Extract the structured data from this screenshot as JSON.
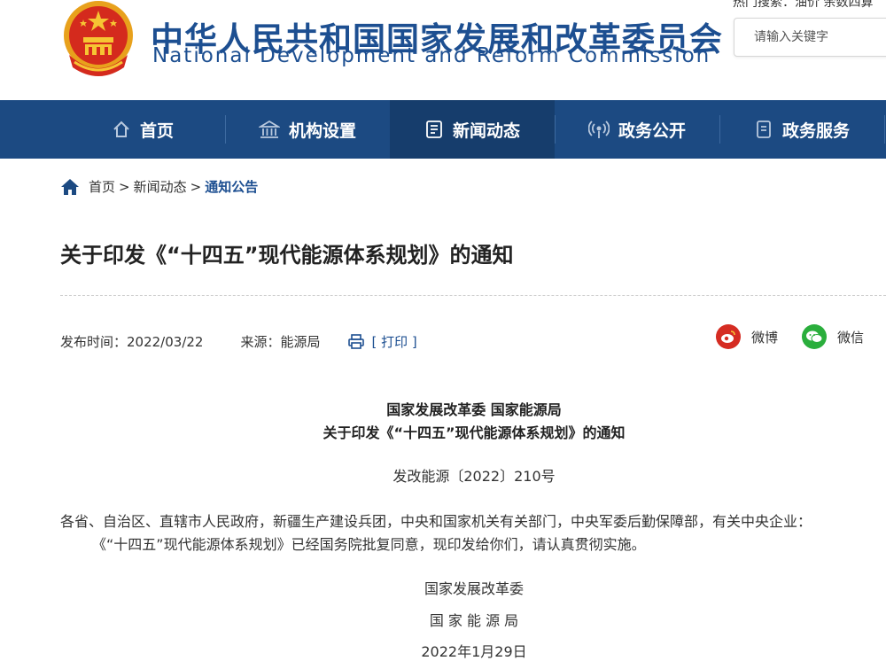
{
  "header": {
    "title_cn": "中华人民共和国国家发展和改革委员会",
    "title_en": "National Development and Reform Commission",
    "hot_search": "热门搜索：油价 余数四算",
    "search_placeholder": "请输入关键字",
    "colors": {
      "brand": "#1d4f91",
      "nav": "#1c4a82",
      "nav_active": "#163d6c"
    }
  },
  "nav": {
    "items": [
      {
        "label": "首页",
        "icon": "home-icon"
      },
      {
        "label": "机构设置",
        "icon": "building-icon"
      },
      {
        "label": "新闻动态",
        "icon": "news-icon"
      },
      {
        "label": "政务公开",
        "icon": "broadcast-icon"
      },
      {
        "label": "政务服务",
        "icon": "document-icon"
      }
    ],
    "active": "新闻动态"
  },
  "breadcrumb": {
    "home": "首页",
    "sep": ">",
    "level2": "新闻动态",
    "current": "通知公告"
  },
  "article": {
    "title": "关于印发《“十四五”现代能源体系规划》的通知",
    "publish_time": "发布时间：2022/03/22",
    "source": "来源：能源局",
    "print_label": "[ 打印 ]",
    "share": {
      "weibo": "微博",
      "wechat": "微信"
    },
    "head_line1": "国家发展改革委 国家能源局",
    "head_line2": "关于印发《“十四五”现代能源体系规划》的通知",
    "doc_number": "发改能源〔2022〕210号",
    "para1": "各省、自治区、直辖市人民政府，新疆生产建设兵团，中央和国家机关有关部门，中央军委后勤保障部，有关中央企业：",
    "para2": "《“十四五”现代能源体系规划》已经国务院批复同意，现印发给你们，请认真贯彻实施。",
    "sign1": "国家发展改革委",
    "sign2": "国 家 能 源 局",
    "date": "2022年1月29日"
  }
}
